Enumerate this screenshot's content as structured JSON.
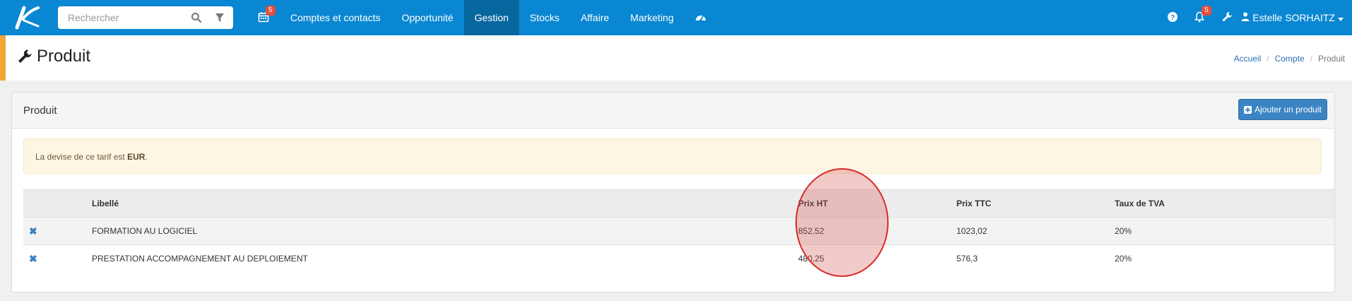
{
  "search": {
    "placeholder": "Rechercher"
  },
  "nav": {
    "calendar_badge": "5",
    "items": [
      "Comptes et contacts",
      "Opportunité",
      "Gestion",
      "Stocks",
      "Affaire",
      "Marketing"
    ]
  },
  "topright": {
    "notif_badge": "5",
    "user_name": "Estelle SORHAITZ"
  },
  "page": {
    "title": "Produit"
  },
  "breadcrumb": {
    "home": "Accueil",
    "account": "Compte",
    "current": "Produit"
  },
  "panel": {
    "title": "Produit",
    "add_button": "Ajouter un produit"
  },
  "alert": {
    "prefix": "La devise de ce tarif est ",
    "currency": "EUR",
    "suffix": "."
  },
  "table": {
    "headers": {
      "label": "Libellé",
      "prix_ht": "Prix HT",
      "prix_ttc": "Prix TTC",
      "tva": "Taux de TVA"
    },
    "rows": [
      {
        "label": "FORMATION AU LOGICIEL",
        "prix_ht": "852,52",
        "prix_ttc": "1023,02",
        "tva": "20%"
      },
      {
        "label": "PRESTATION ACCOMPAGNEMENT AU DEPLOIEMENT",
        "prix_ht": "480,25",
        "prix_ttc": "576,3",
        "tva": "20%"
      }
    ]
  },
  "colors": {
    "topbar": "#0a87d2",
    "active_nav": "#08679f",
    "accent": "#f0a536",
    "highlight": "#d92b2b"
  },
  "icons": [
    "logo-icon",
    "search-icon",
    "filter-icon",
    "calendar-icon",
    "dashboard-icon",
    "help-icon",
    "bell-icon",
    "wrench-icon",
    "user-icon",
    "plus-icon",
    "delete-icon"
  ]
}
